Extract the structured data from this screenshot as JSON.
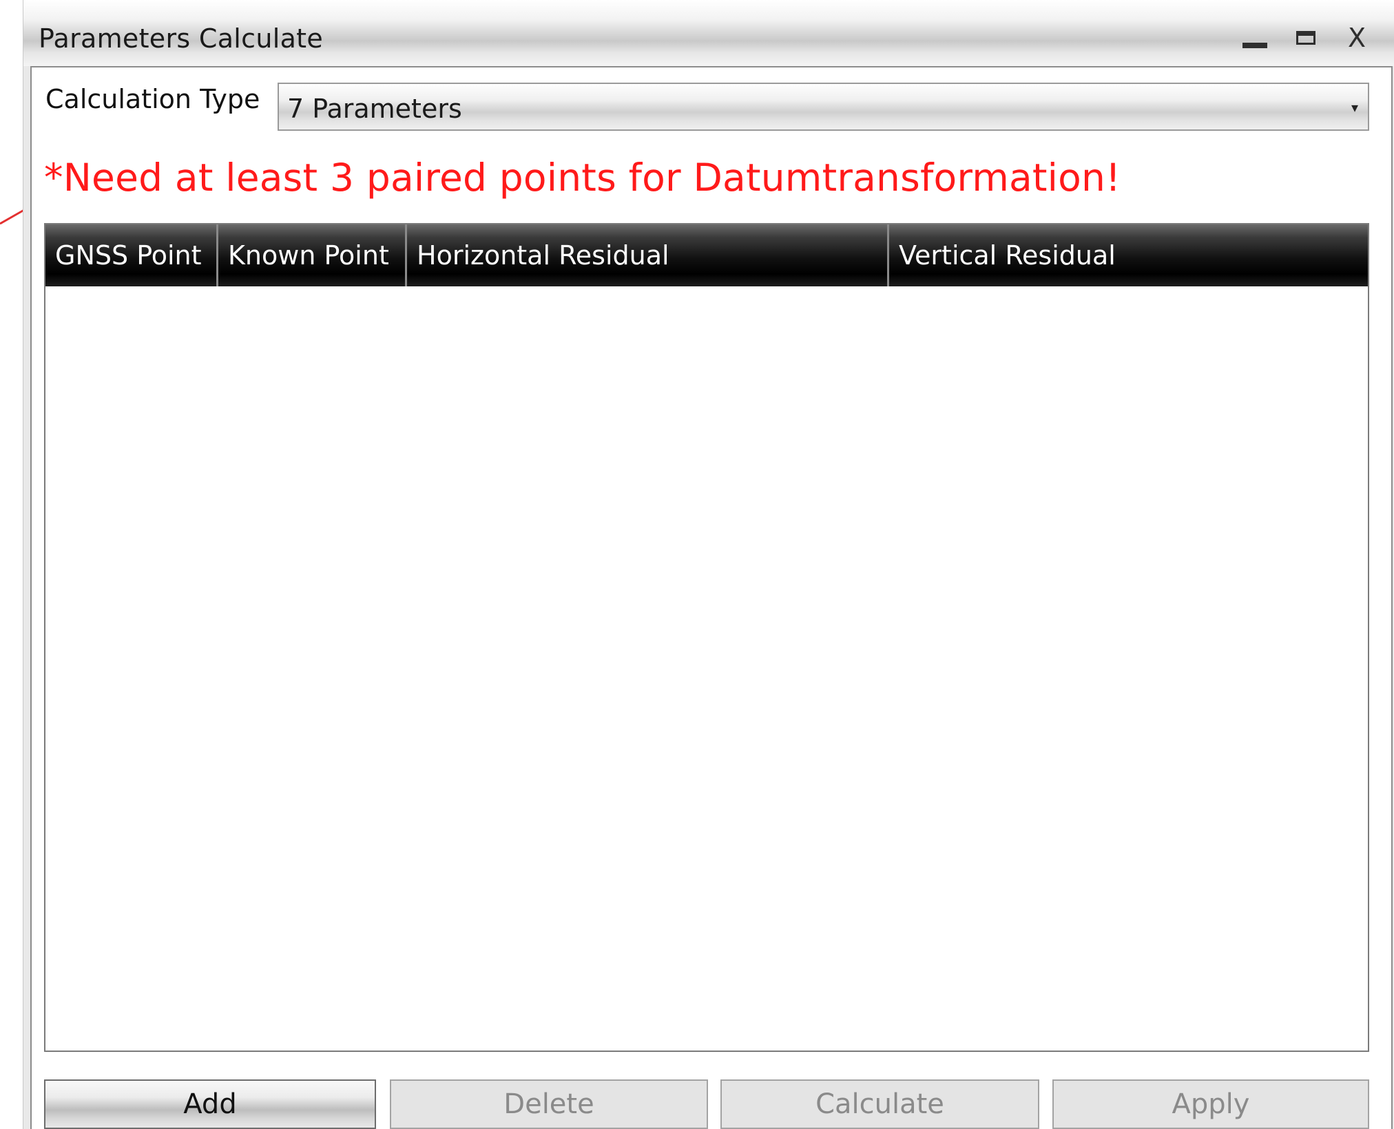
{
  "window": {
    "title": "Parameters Calculate",
    "controls": {
      "minimize": "minimize-icon",
      "maximize": "maximize-icon",
      "close_glyph": "X"
    }
  },
  "calculation_type": {
    "label": "Calculation Type",
    "selected": "7 Parameters",
    "arrow": "▾"
  },
  "warning": {
    "text": "*Need at least 3 paired points for Datumtransformation!",
    "color": "#ff1a1a"
  },
  "table": {
    "columns": [
      "GNSS Point",
      "Known Point",
      "Horizontal Residual",
      "Vertical Residual"
    ],
    "rows": []
  },
  "buttons": {
    "add": "Add",
    "delete": "Delete",
    "calculate": "Calculate",
    "apply": "Apply"
  }
}
